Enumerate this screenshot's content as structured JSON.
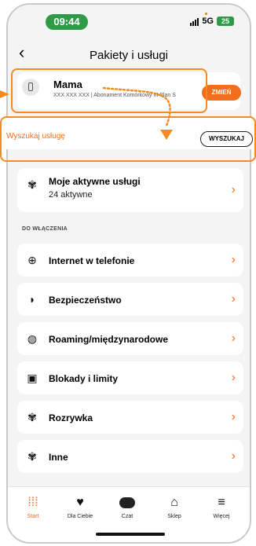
{
  "status": {
    "time": "09:44",
    "network": "5G",
    "battery": "25"
  },
  "header": {
    "title": "Pakiety i usługi"
  },
  "account": {
    "name": "Mama",
    "details": "XXX XXX XXX | Abonament Komórkowy III Plan S",
    "change_label": "ZMIEŃ"
  },
  "search": {
    "label": "Wyszukaj usługę",
    "button": "WYSZUKAJ"
  },
  "active": {
    "title": "Moje aktywne usługi",
    "subtitle": "24 aktywne"
  },
  "section": {
    "title": "DO WŁĄCZENIA"
  },
  "items": [
    {
      "label": "Internet w telefonie",
      "icon": "globe-icon"
    },
    {
      "label": "Bezpieczeństwo",
      "icon": "shield-icon"
    },
    {
      "label": "Roaming/międzynarodowe",
      "icon": "world-icon"
    },
    {
      "label": "Blokady i limity",
      "icon": "lock-icon"
    },
    {
      "label": "Rozrywka",
      "icon": "ticket-icon"
    },
    {
      "label": "Inne",
      "icon": "ticket-icon"
    }
  ],
  "tabs": [
    {
      "label": "Start",
      "icon": "grid-icon",
      "active": true
    },
    {
      "label": "Dla Ciebie",
      "icon": "heart-icon",
      "active": false
    },
    {
      "label": "Czat",
      "icon": "chat-icon",
      "active": false
    },
    {
      "label": "Sklep",
      "icon": "basket-icon",
      "active": false
    },
    {
      "label": "Więcej",
      "icon": "menu-icon",
      "active": false
    }
  ],
  "colors": {
    "accent": "#f06e1e",
    "annotation": "#f58a1f",
    "status_green": "#2f9a48"
  }
}
